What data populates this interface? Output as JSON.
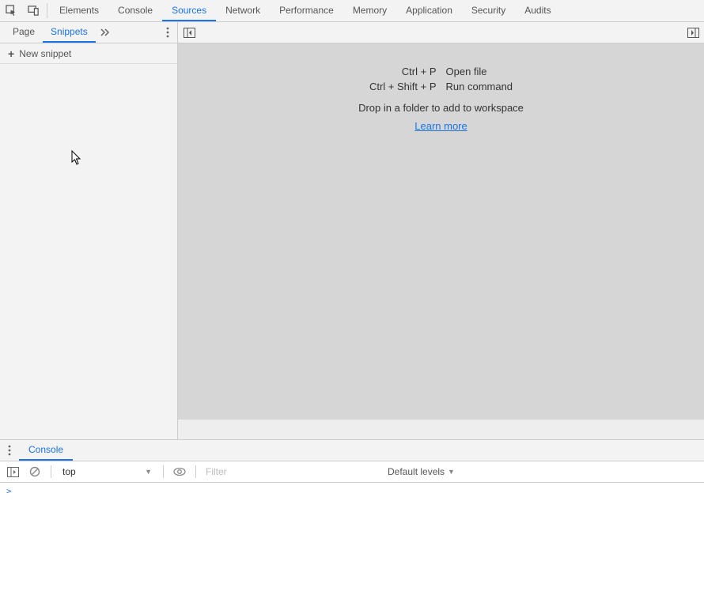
{
  "topTabs": {
    "elements": "Elements",
    "console": "Console",
    "sources": "Sources",
    "network": "Network",
    "performance": "Performance",
    "memory": "Memory",
    "application": "Application",
    "security": "Security",
    "audits": "Audits"
  },
  "subTabs": {
    "page": "Page",
    "snippets": "Snippets"
  },
  "sidebar": {
    "new_snippet": "New snippet"
  },
  "hints": {
    "open_file_key": "Ctrl + P",
    "open_file_action": "Open file",
    "run_command_key": "Ctrl + Shift + P",
    "run_command_action": "Run command",
    "drop_message": "Drop in a folder to add to workspace",
    "learn_more": "Learn more"
  },
  "drawer": {
    "console_tab": "Console"
  },
  "consoleToolbar": {
    "context": "top",
    "filter_placeholder": "Filter",
    "levels": "Default levels"
  },
  "consoleBody": {
    "prompt": ">"
  }
}
